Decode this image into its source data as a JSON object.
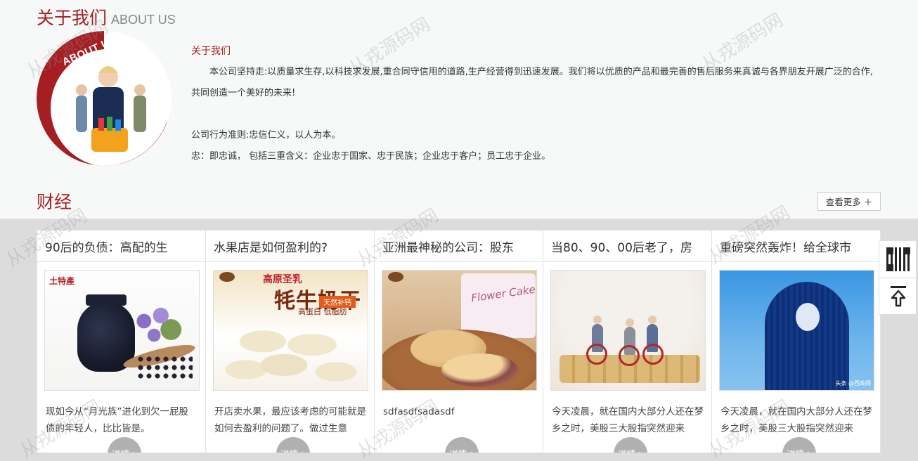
{
  "about": {
    "heading_cn": "关于我们",
    "heading_en": "ABOUT US",
    "image_caption": "ABOUT US",
    "subheading": "关于我们",
    "paragraph": "本公司坚持走:以质量求生存,以科技求发展,重合同守信用的道路,生产经营得到迅速发展。我们将以优质的产品和最完善的售后服务来真诚与各界朋友开展广泛的合作,共同创造一个美好的未来!",
    "line_1": "公司行为准则:忠信仁义，以人为本。",
    "line_2": "忠：即忠诚，  包括三重含义：企业忠于国家、忠于民族；企业忠于客户；员工忠于企业。"
  },
  "finance": {
    "title": "财经",
    "more_button": "查看更多 ＋",
    "detail_label": "详情+",
    "cards": [
      {
        "title": "90后的负债：高配的生",
        "desc": "现如今从“月光族”进化到欠一屁股债的年轻人，比比皆是。",
        "image_icon": "jar-image",
        "brand": "土特產"
      },
      {
        "title": "水果店是如何盈利的?",
        "desc": "开店卖水果，最应该考虑的可能就是如何去盈利的问题了。做过生意",
        "image_icon": "yak-milk-image",
        "img_top": "高原圣乳",
        "img_big": "牦牛奶干",
        "img_tag": "天然补钙",
        "img_sub": "高蛋白 低脂肪"
      },
      {
        "title": "亚洲最神秘的公司：股东",
        "desc": "sdfasdfsadasdf",
        "image_icon": "pastry-image",
        "img_bag": "Flower Cake"
      },
      {
        "title": "当80、90、00后老了，房",
        "desc": "今天凌晨，就在国内大部分人还在梦乡之时，美股三大股指突然迎来",
        "image_icon": "elderly-coins-image"
      },
      {
        "title": "重磅突然轰炸！给全球市",
        "desc": "今天凌晨，就在国内大部分人还在梦乡之时，美股三大股指突然迎来",
        "image_icon": "tower-image",
        "img_caption": "头条 @西政网"
      }
    ]
  },
  "float_tools": {
    "qr_icon": "qr-code-icon",
    "top_icon": "back-to-top-icon"
  },
  "watermark": "从戎源码网",
  "colors": {
    "brand_red": "#a51e22",
    "page_bg": "#f7f8f8",
    "finance_bg": "#dcdcdc",
    "detail_btn": "#b0b0b0"
  }
}
